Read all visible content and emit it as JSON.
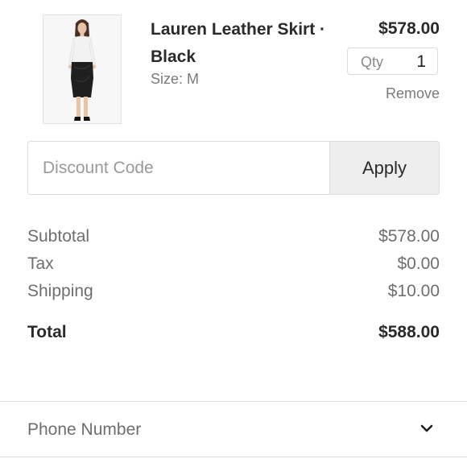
{
  "cart_item": {
    "name": "Lauren Leather Skirt · Black",
    "size": "Size: M",
    "price": "$578.00",
    "qty_label": "Qty",
    "qty_value": "1",
    "remove_label": "Remove",
    "image": "product-photo-leather-skirt"
  },
  "discount": {
    "placeholder": "Discount Code",
    "value": "",
    "apply_label": "Apply"
  },
  "summary": {
    "subtotal_label": "Subtotal",
    "subtotal_value": "$578.00",
    "tax_label": "Tax",
    "tax_value": "$0.00",
    "shipping_label": "Shipping",
    "shipping_value": "$10.00",
    "total_label": "Total",
    "total_value": "$588.00"
  },
  "phone": {
    "label": "Phone Number",
    "icon": "chevron-down-icon"
  }
}
